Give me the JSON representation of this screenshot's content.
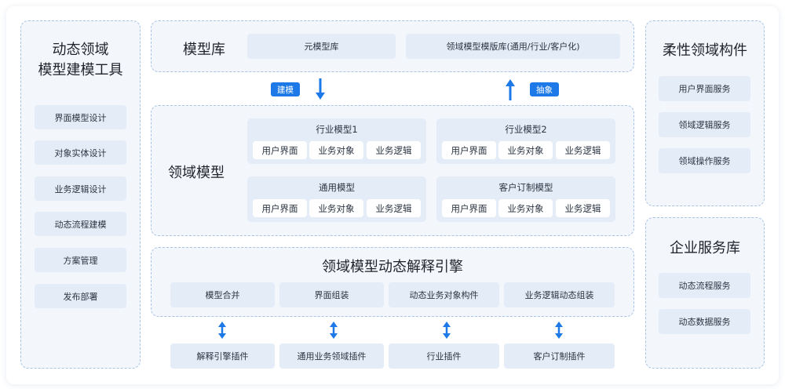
{
  "left_panel": {
    "title_line1": "动态领域",
    "title_line2": "模型建模工具",
    "items": [
      "界面模型设计",
      "对象实体设计",
      "业务逻辑设计",
      "动态流程建模",
      "方案管理",
      "发布部署"
    ]
  },
  "model_library": {
    "title": "模型库",
    "items": [
      "元模型库",
      "领域模型模版库(通用/行业/客户化)"
    ]
  },
  "flow": {
    "build_label": "建模",
    "abstract_label": "抽象"
  },
  "domain_model": {
    "title": "领域模型",
    "groups": [
      {
        "title": "行业模型1",
        "items": [
          "用户界面",
          "业务对象",
          "业务逻辑"
        ]
      },
      {
        "title": "行业模型2",
        "items": [
          "用户界面",
          "业务对象",
          "业务逻辑"
        ]
      },
      {
        "title": "通用模型",
        "items": [
          "用户界面",
          "业务对象",
          "业务逻辑"
        ]
      },
      {
        "title": "客户订制模型",
        "items": [
          "用户界面",
          "业务对象",
          "业务逻辑"
        ]
      }
    ]
  },
  "engine": {
    "title": "领域模型动态解释引擎",
    "items": [
      "模型合并",
      "界面组装",
      "动态业务对象构件",
      "业务逻辑动态组装"
    ]
  },
  "plugins": [
    "解释引擎插件",
    "通用业务领域插件",
    "行业插件",
    "客户订制插件"
  ],
  "right_top": {
    "title": "柔性领域构件",
    "items": [
      "用户界面服务",
      "领域逻辑服务",
      "领域操作服务"
    ]
  },
  "right_bottom": {
    "title": "企业服务库",
    "items": [
      "动态流程服务",
      "动态数据服务"
    ]
  },
  "colors": {
    "accent": "#1d79e8",
    "panel_bg": "#f3f7fc",
    "chip_bg": "#e4ecf7",
    "border": "#a9c3e4"
  }
}
